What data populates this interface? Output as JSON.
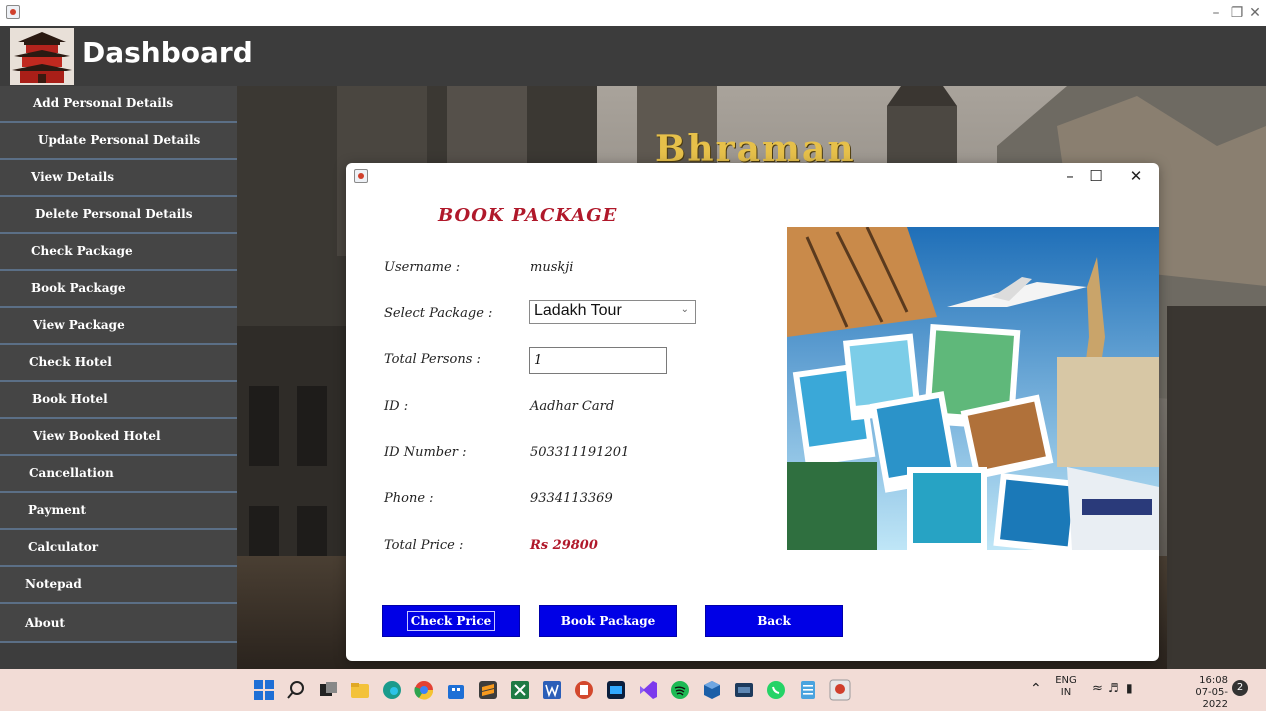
{
  "header": {
    "title": "Dashboard"
  },
  "sidebar": {
    "items": [
      {
        "label": "Add Personal Details"
      },
      {
        "label": "Update Personal Details"
      },
      {
        "label": "View Details"
      },
      {
        "label": "Delete Personal Details"
      },
      {
        "label": "Check Package"
      },
      {
        "label": "Book Package"
      },
      {
        "label": "View Package"
      },
      {
        "label": "Check Hotel"
      },
      {
        "label": "Book Hotel"
      },
      {
        "label": "View Booked Hotel"
      },
      {
        "label": "Cancellation"
      },
      {
        "label": "Payment"
      },
      {
        "label": "Calculator"
      },
      {
        "label": "Notepad"
      },
      {
        "label": "About"
      }
    ]
  },
  "background": {
    "brand": "Bhraman"
  },
  "dialog": {
    "heading": "BOOK PACKAGE",
    "username_label": "Username :",
    "username_value": "muskji",
    "package_label": "Select Package :",
    "package_selected": "Ladakh Tour",
    "persons_label": "Total Persons :",
    "persons_value": "1",
    "id_label": "ID :",
    "id_value": "Aadhar Card",
    "idnum_label": "ID Number :",
    "idnum_value": "503311191201",
    "phone_label": "Phone :",
    "phone_value": "9334113369",
    "price_label": "Total Price :",
    "price_value": "Rs 29800",
    "buttons": {
      "check_price": "Check Price",
      "book_package": "Book Package",
      "back": "Back"
    }
  },
  "taskbar": {
    "lang_line1": "ENG",
    "lang_line2": "IN",
    "time": "16:08",
    "date": "07-05-2022",
    "notification_count": "2"
  },
  "colors": {
    "header_bg": "#3c3c3c",
    "sidebar_item_bg": "#454545",
    "sidebar_divider": "#5b6f86",
    "button_bg": "#0000e6",
    "heading_red": "#b0182a",
    "taskbar_bg": "#f2dcd6"
  }
}
